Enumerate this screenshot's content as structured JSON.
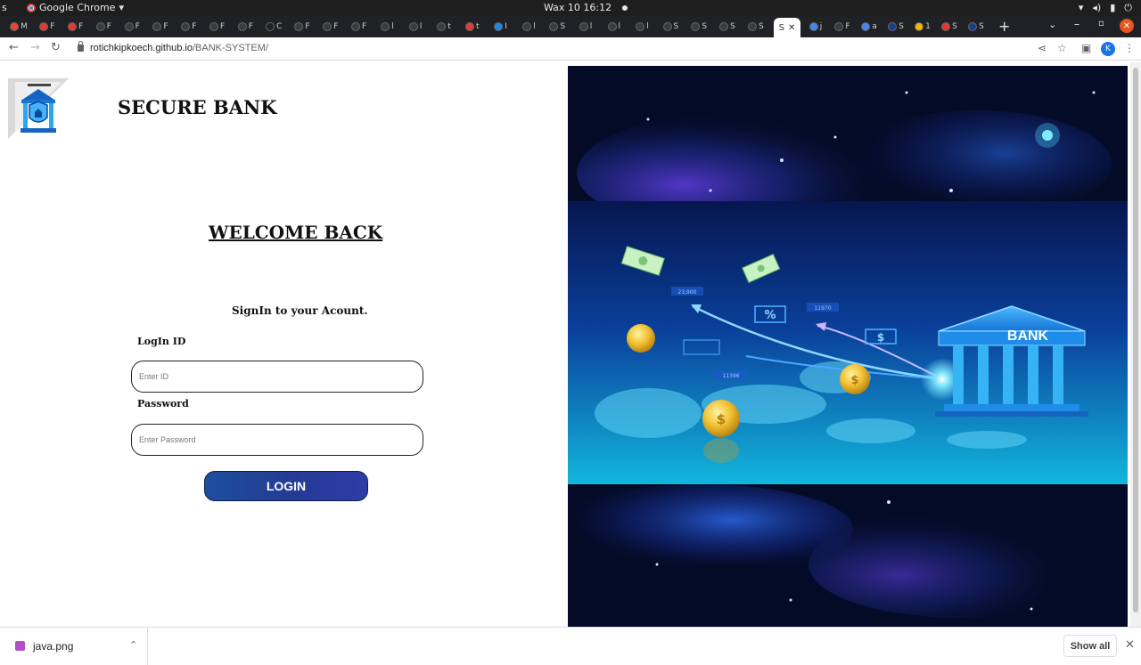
{
  "os_bar": {
    "left_glyph": "s",
    "app_name": "Google Chrome",
    "app_menu": "▾",
    "clock": "Wax 10  16:12",
    "tray_icons": [
      "wifi-icon",
      "volume-icon",
      "battery-icon",
      "power-icon"
    ]
  },
  "tabs": {
    "mini": [
      {
        "letter": "M",
        "color": "#ea4335"
      },
      {
        "letter": "F",
        "color": "#e53935"
      },
      {
        "letter": "F",
        "color": "#e53935"
      },
      {
        "letter": "F",
        "color": "#3c3c3c"
      },
      {
        "letter": "F",
        "color": "#3c3c3c"
      },
      {
        "letter": "F",
        "color": "#3c3c3c"
      },
      {
        "letter": "F",
        "color": "#3c3c3c"
      },
      {
        "letter": "F",
        "color": "#3c3c3c"
      },
      {
        "letter": "F",
        "color": "#3c3c3c"
      },
      {
        "letter": "C",
        "color": "#222222"
      },
      {
        "letter": "F",
        "color": "#3c3c3c"
      },
      {
        "letter": "F",
        "color": "#3c3c3c"
      },
      {
        "letter": "F",
        "color": "#3c3c3c"
      },
      {
        "letter": "l",
        "color": "#3c3c3c"
      },
      {
        "letter": "l",
        "color": "#3c3c3c"
      },
      {
        "letter": "t",
        "color": "#3c3c3c"
      },
      {
        "letter": "t",
        "color": "#e53935"
      },
      {
        "letter": "I",
        "color": "#1e88e5"
      },
      {
        "letter": "l",
        "color": "#3c3c3c"
      },
      {
        "letter": "S",
        "color": "#3c3c3c"
      },
      {
        "letter": "l",
        "color": "#3c3c3c"
      },
      {
        "letter": "l",
        "color": "#3c3c3c"
      },
      {
        "letter": "l",
        "color": "#3c3c3c"
      },
      {
        "letter": "S",
        "color": "#3c3c3c"
      },
      {
        "letter": "S",
        "color": "#3c3c3c"
      },
      {
        "letter": "S",
        "color": "#3c3c3c"
      },
      {
        "letter": "S",
        "color": "#3c3c3c"
      }
    ],
    "mini_after": [
      {
        "letter": "j",
        "color": "#4285f4"
      },
      {
        "letter": "F",
        "color": "#3c3c3c"
      },
      {
        "letter": "a",
        "color": "#4285f4"
      },
      {
        "letter": "S",
        "color": "#1e3a8a"
      },
      {
        "letter": "1",
        "color": "#f4b400"
      },
      {
        "letter": "S",
        "color": "#e53935"
      },
      {
        "letter": "S",
        "color": "#1e3a8a"
      }
    ],
    "active_label": "S",
    "active_close": "✕",
    "new_tab": "+",
    "tab_search": "⌄",
    "minimize": "–",
    "maximize": "▫",
    "close": "✕"
  },
  "toolbar": {
    "back": "←",
    "forward": "→",
    "reload": "↻",
    "url_host": "rotichkipkoech.github.io",
    "url_path": "/BANK-SYSTEM/",
    "share": "⋖",
    "bookmark": "☆",
    "sidepanel": "▣",
    "profile_initial": "K",
    "menu": "⋮"
  },
  "page": {
    "brand_title": "SECURE BANK",
    "welcome": "WELCOME BACK",
    "signin_subtitle": "SignIn to your Acount.",
    "login_id_label": "LogIn ID",
    "login_id_placeholder": "Enter ID",
    "password_label": "Password",
    "password_placeholder": "Enter Password",
    "login_button": "LOGIN"
  },
  "hero": {
    "bank_label": "BANK",
    "percent_badge": "%",
    "dollar_badge": "$",
    "coin_symbol": "$",
    "tags": [
      "23,900",
      "11970",
      "11396"
    ]
  },
  "download_bar": {
    "file_name": "java.png",
    "chevron": "⌃",
    "show_all": "Show all",
    "close": "✕"
  }
}
